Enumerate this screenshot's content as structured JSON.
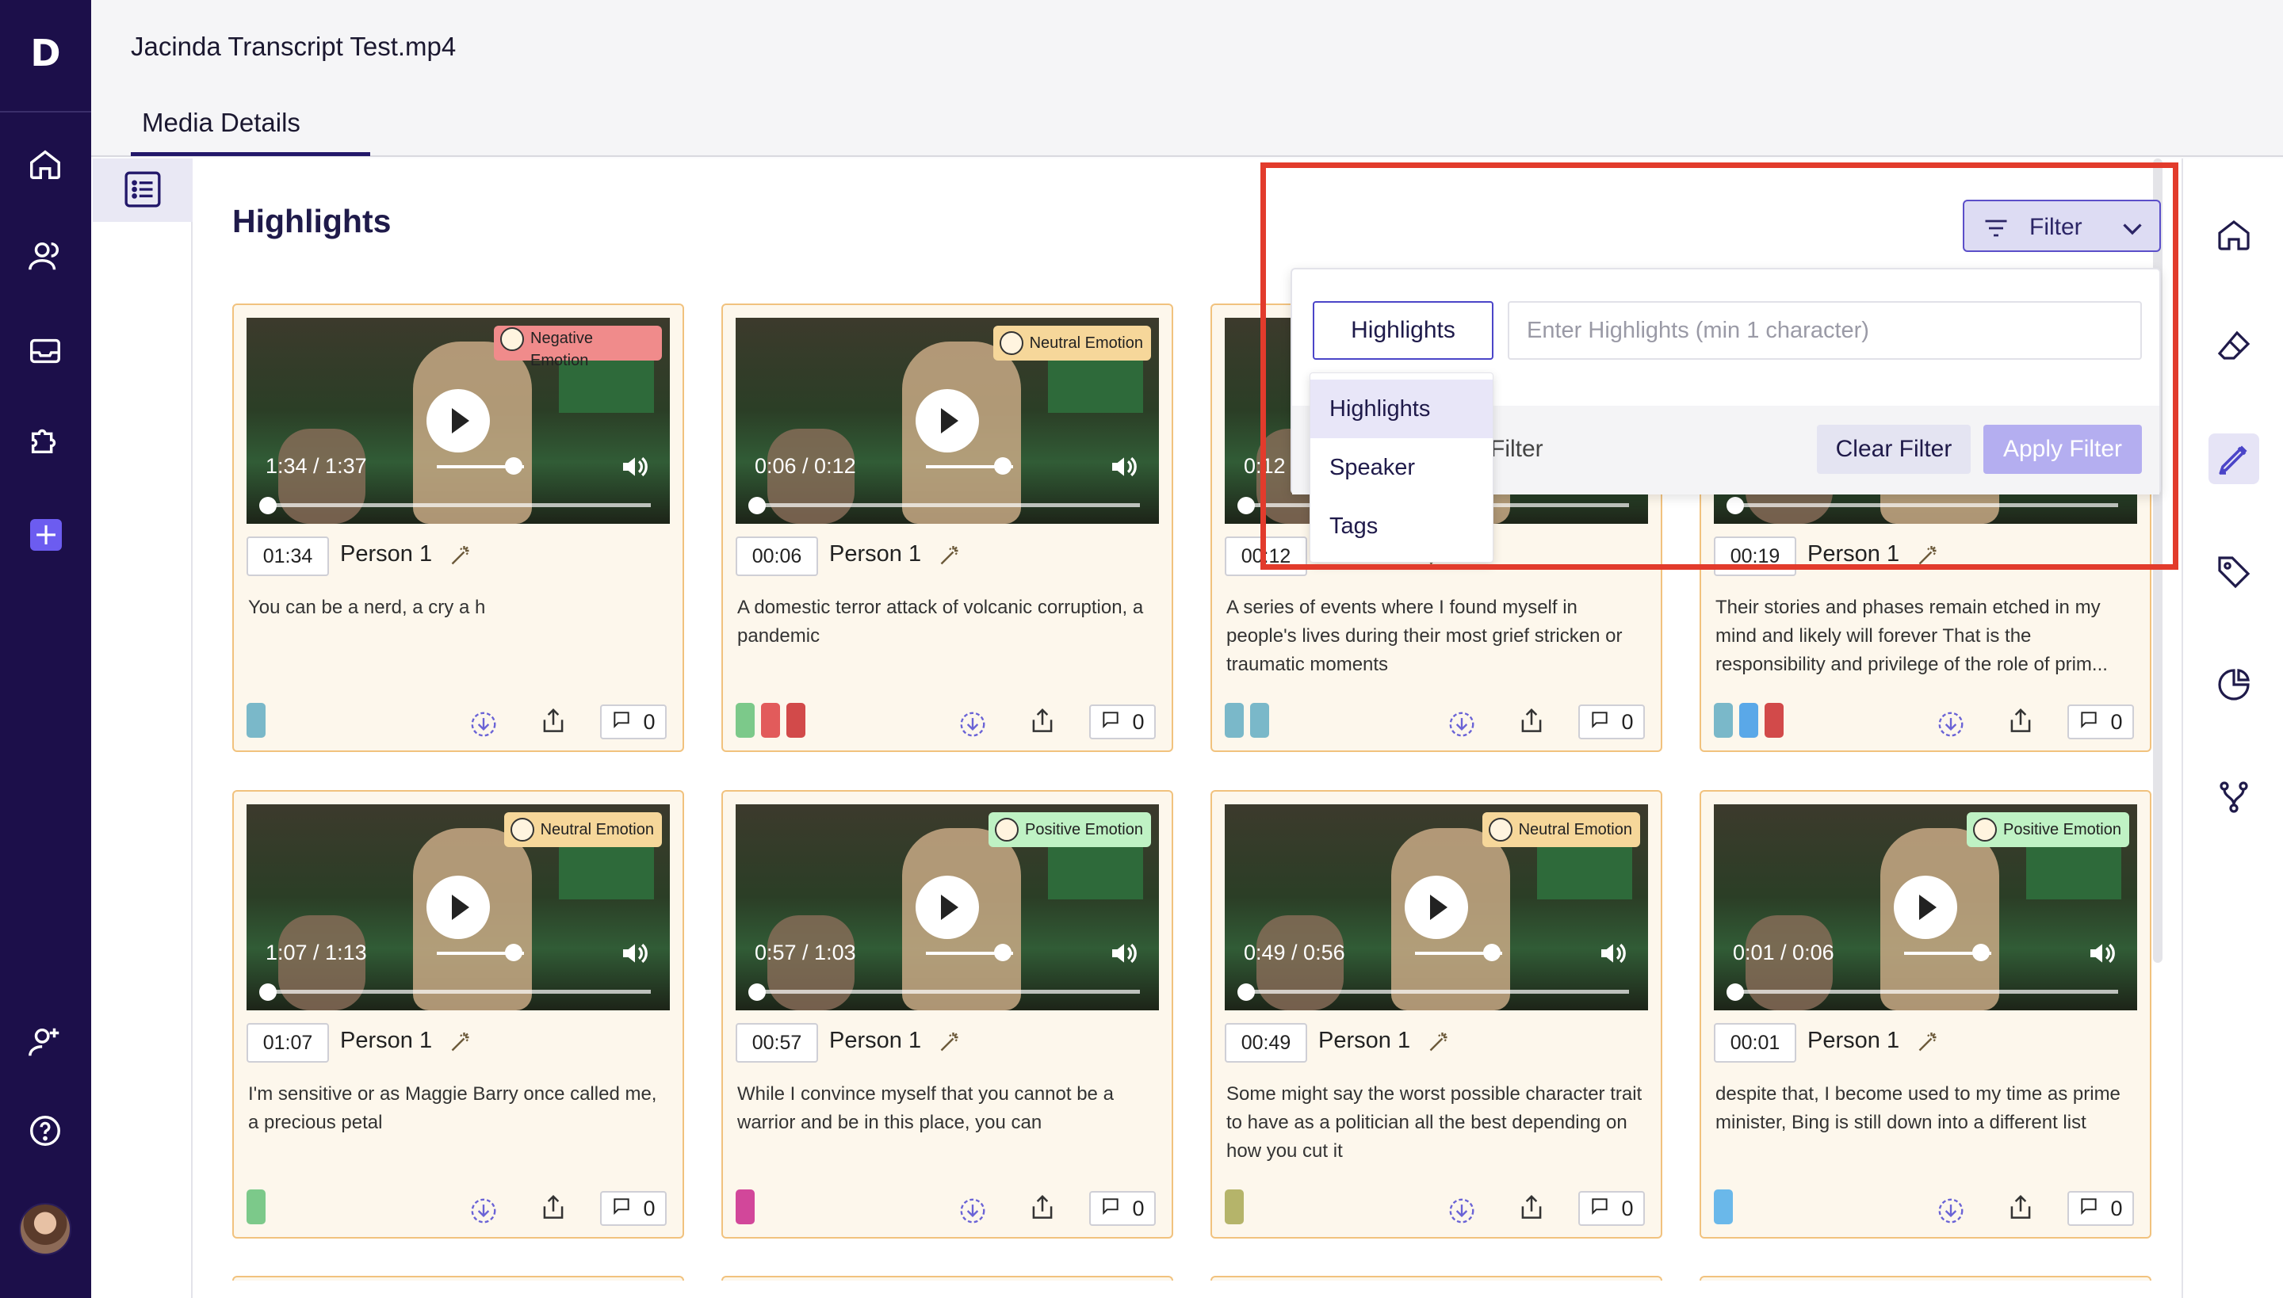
{
  "app": {
    "logo": "D"
  },
  "header": {
    "file_title": "Jacinda Transcript Test.mp4",
    "tab_label": "Media Details"
  },
  "page": {
    "title": "Highlights"
  },
  "filter": {
    "button_label": "Filter",
    "select_value": "Highlights",
    "search_placeholder": "Enter Highlights (min 1 character)",
    "footer_label": "Filter",
    "clear_label": "Clear Filter",
    "apply_label": "Apply Filter",
    "options": [
      "Highlights",
      "Speaker",
      "Tags"
    ]
  },
  "cards": [
    {
      "emotion": "Negative Emotion",
      "emotion_type": "negative",
      "video_time": "1:34 / 1:37",
      "timestamp": "01:34",
      "speaker": "Person 1",
      "text": "You can be a nerd, a cry a h",
      "tags": [
        "#7ab8c9"
      ],
      "comments": "0"
    },
    {
      "emotion": "Neutral Emotion",
      "emotion_type": "neutral",
      "video_time": "0:06 / 0:12",
      "timestamp": "00:06",
      "speaker": "Person 1",
      "text": "A domestic terror attack of volcanic corruption, a pandemic",
      "tags": [
        "#7cc98a",
        "#e25b5b",
        "#d24a4a"
      ],
      "comments": "0"
    },
    {
      "emotion": "",
      "emotion_type": "",
      "video_time": "0:12",
      "timestamp": "00:12",
      "speaker": "Person 1",
      "text": "A series of events where I found myself in people's lives during their most grief stricken or traumatic moments",
      "tags": [
        "#7ab8c9",
        "#7ab8c9"
      ],
      "comments": "0"
    },
    {
      "emotion": "",
      "emotion_type": "",
      "video_time": "",
      "timestamp": "00:19",
      "speaker": "Person 1",
      "text": "Their stories and phases remain etched in my mind and likely will forever That is the responsibility and privilege of the role of prim...",
      "tags": [
        "#7ab8c9",
        "#5aa8e8",
        "#d24a4a"
      ],
      "comments": "0"
    },
    {
      "emotion": "Neutral Emotion",
      "emotion_type": "neutral",
      "video_time": "1:07 / 1:13",
      "timestamp": "01:07",
      "speaker": "Person 1",
      "text": "I'm sensitive or as Maggie Barry once called me, a precious petal",
      "tags": [
        "#7cc98a"
      ],
      "comments": "0"
    },
    {
      "emotion": "Positive Emotion",
      "emotion_type": "positive",
      "video_time": "0:57 / 1:03",
      "timestamp": "00:57",
      "speaker": "Person 1",
      "text": "While I convince myself that you cannot be a warrior and be in this place, you can",
      "tags": [
        "#d2479a"
      ],
      "comments": "0"
    },
    {
      "emotion": "Neutral Emotion",
      "emotion_type": "neutral",
      "video_time": "0:49 / 0:56",
      "timestamp": "00:49",
      "speaker": "Person 1",
      "text": "Some might say the worst possible character trait to have as a politician all the best depending on how you cut it",
      "tags": [
        "#b5b46a"
      ],
      "comments": "0"
    },
    {
      "emotion": "Positive Emotion",
      "emotion_type": "positive",
      "video_time": "0:01 / 0:06",
      "timestamp": "00:01",
      "speaker": "Person 1",
      "text": "despite that, I become used to my time as prime minister, Bing is still down into a different list",
      "tags": [
        "#6ab8ea"
      ],
      "comments": "0"
    }
  ]
}
